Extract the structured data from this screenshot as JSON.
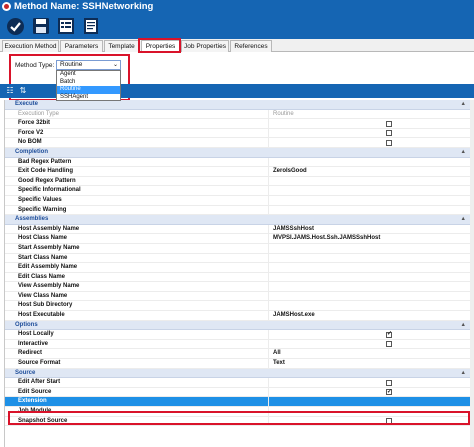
{
  "window": {
    "title": "Method Name: SSHNetworking"
  },
  "toolbar": {
    "buttons": [
      "save-check-icon",
      "save-icon",
      "properties-icon",
      "text-editor-icon"
    ]
  },
  "tabs": [
    {
      "label": "Execution Method",
      "active": false
    },
    {
      "label": "Parameters",
      "active": false
    },
    {
      "label": "Template",
      "active": false
    },
    {
      "label": "Properties",
      "active": true
    },
    {
      "label": "Job Properties",
      "active": false
    },
    {
      "label": "References",
      "active": false
    }
  ],
  "method_type": {
    "label": "Method Type:",
    "selected": "Routine",
    "options": [
      "Agent",
      "Batch",
      "Routine",
      "SSHAgent"
    ]
  },
  "grid": {
    "sections": [
      {
        "title": "Execute",
        "rows": [
          {
            "name": "Execution Type",
            "value": "Routine",
            "type": "text-gray",
            "disabled": true
          },
          {
            "name": "Force 32bit",
            "value": "",
            "type": "checkbox",
            "checked": false
          },
          {
            "name": "Force V2",
            "value": "",
            "type": "checkbox",
            "checked": false
          },
          {
            "name": "No BOM",
            "value": "",
            "type": "checkbox",
            "checked": false
          }
        ]
      },
      {
        "title": "Completion",
        "rows": [
          {
            "name": "Bad Regex Pattern",
            "value": "",
            "type": "text"
          },
          {
            "name": "Exit Code Handling",
            "value": "ZeroIsGood",
            "type": "text"
          },
          {
            "name": "Good Regex Pattern",
            "value": "",
            "type": "text"
          },
          {
            "name": "Specific Informational",
            "value": "",
            "type": "text"
          },
          {
            "name": "Specific Values",
            "value": "",
            "type": "text"
          },
          {
            "name": "Specific Warning",
            "value": "",
            "type": "text"
          }
        ]
      },
      {
        "title": "Assemblies",
        "rows": [
          {
            "name": "Host Assembly Name",
            "value": "JAMSSshHost",
            "type": "text"
          },
          {
            "name": "Host Class Name",
            "value": "MVPSI.JAMS.Host.Ssh.JAMSSshHost",
            "type": "text"
          },
          {
            "name": "Start Assembly Name",
            "value": "",
            "type": "text"
          },
          {
            "name": "Start Class Name",
            "value": "",
            "type": "text"
          },
          {
            "name": "Edit Assembly Name",
            "value": "",
            "type": "text"
          },
          {
            "name": "Edit Class Name",
            "value": "",
            "type": "text"
          },
          {
            "name": "View Assembly Name",
            "value": "",
            "type": "text"
          },
          {
            "name": "View Class Name",
            "value": "",
            "type": "text"
          },
          {
            "name": "Host Sub Directory",
            "value": "",
            "type": "text"
          },
          {
            "name": "Host Executable",
            "value": "JAMSHost.exe",
            "type": "text"
          }
        ]
      },
      {
        "title": "Options",
        "rows": [
          {
            "name": "Host Locally",
            "value": "",
            "type": "checkbox",
            "checked": true
          },
          {
            "name": "Interactive",
            "value": "",
            "type": "checkbox",
            "checked": false
          },
          {
            "name": "Redirect",
            "value": "All",
            "type": "text"
          },
          {
            "name": "Source Format",
            "value": "Text",
            "type": "text"
          }
        ]
      },
      {
        "title": "Source",
        "rows": [
          {
            "name": "Edit After Start",
            "value": "",
            "type": "checkbox",
            "checked": false
          },
          {
            "name": "Edit Source",
            "value": "",
            "type": "checkbox",
            "checked": true
          },
          {
            "name": "Extension",
            "value": "",
            "type": "text",
            "selected": true
          },
          {
            "name": "Job Module",
            "value": "",
            "type": "text"
          },
          {
            "name": "Snapshot Source",
            "value": "",
            "type": "checkbox",
            "checked": false
          }
        ]
      }
    ]
  },
  "colors": {
    "accent": "#1565b3",
    "highlight": "#d9132a",
    "selection": "#1e90e6"
  }
}
